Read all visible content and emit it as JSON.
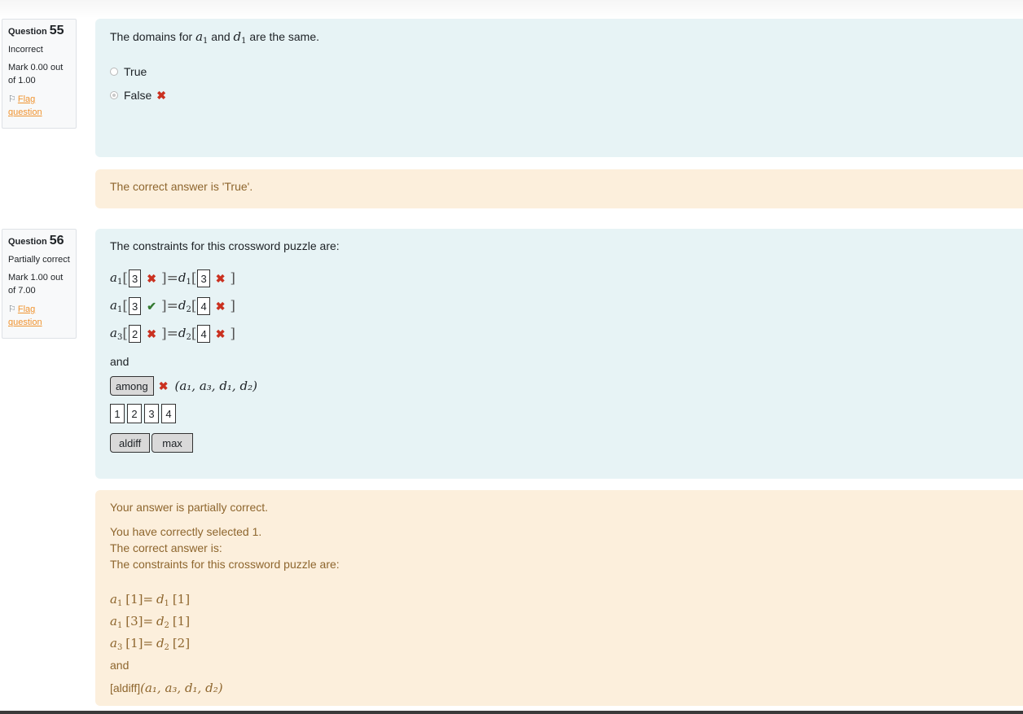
{
  "questions": [
    {
      "label": "Question",
      "number": "55",
      "state": "Incorrect",
      "grade": "Mark 0.00 out of 1.00",
      "flag": "Flag question",
      "prompt_pre": "The domains for",
      "prompt_mid": "and",
      "prompt_post": "are the same.",
      "var1": "a",
      "var1_sub": "1",
      "var2": "d",
      "var2_sub": "1",
      "options": [
        "True",
        "False"
      ],
      "feedback": "The correct answer is 'True'."
    },
    {
      "label": "Question",
      "number": "56",
      "state": "Partially correct",
      "grade": "Mark 1.00 out of 7.00",
      "flag": "Flag question",
      "prompt": "The constraints for this crossword puzzle are:",
      "constraints": [
        {
          "lv": "a",
          "ls": "1",
          "lval": "3",
          "rv": "d",
          "rs": "1",
          "rval": "3"
        },
        {
          "lv": "a",
          "ls": "1",
          "lval": "3",
          "rv": "d",
          "rs": "2",
          "rval": "4"
        },
        {
          "lv": "a",
          "ls": "3",
          "lval": "2",
          "rv": "d",
          "rs": "2",
          "rval": "4"
        }
      ],
      "and_label": "and",
      "function_value": "among",
      "args": "(a₁, a₃, d₁, d₂)",
      "number_options": [
        "1",
        "2",
        "3",
        "4"
      ],
      "function_options": [
        "aldiff",
        "max"
      ],
      "feedback": {
        "line1": "Your answer is partially correct.",
        "line2": "You have correctly selected 1.",
        "line3": "The correct answer is:",
        "line4": "The constraints for this crossword puzzle are:",
        "answers": [
          {
            "lv": "a",
            "ls": "1",
            "lval": "[1]",
            "rv": "d",
            "rs": "1",
            "rval": "[1]"
          },
          {
            "lv": "a",
            "ls": "1",
            "lval": "[3]",
            "rv": "d",
            "rs": "2",
            "rval": "[1]"
          },
          {
            "lv": "a",
            "ls": "3",
            "lval": "[1]",
            "rv": "d",
            "rs": "2",
            "rval": "[2]"
          }
        ],
        "and_label": "and",
        "fn": "[aldiff]",
        "args": "(a₁, a₃, d₁, d₂)"
      }
    }
  ]
}
